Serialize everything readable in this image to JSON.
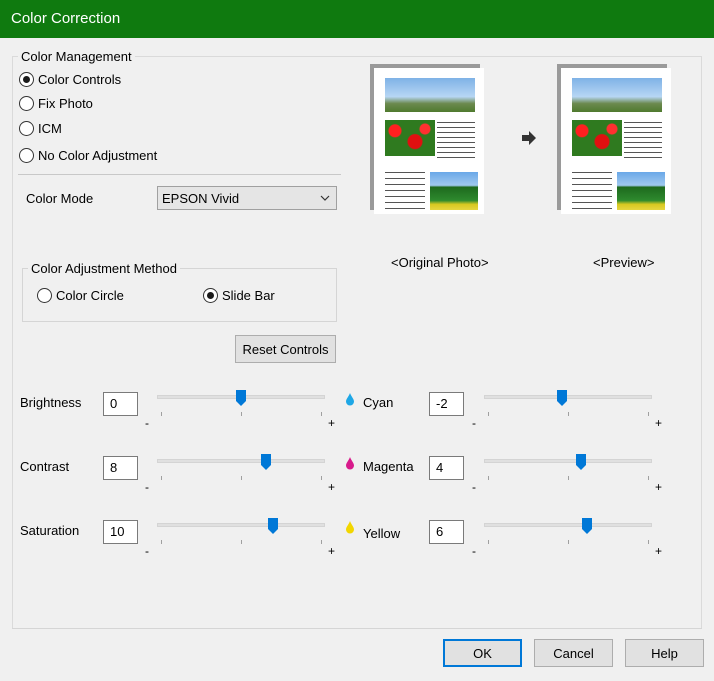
{
  "window": {
    "title": "Color Correction"
  },
  "color_management": {
    "legend": "Color Management",
    "options": [
      {
        "label": "Color Controls",
        "checked": true
      },
      {
        "label": "Fix Photo",
        "checked": false
      },
      {
        "label": "ICM",
        "checked": false
      },
      {
        "label": "No Color Adjustment",
        "checked": false
      }
    ],
    "color_mode_label": "Color Mode",
    "color_mode_value": "EPSON Vivid"
  },
  "preview": {
    "original_label": "<Original Photo>",
    "preview_label": "<Preview>"
  },
  "adjustment_method": {
    "legend": "Color Adjustment Method",
    "options": [
      {
        "label": "Color Circle",
        "checked": false
      },
      {
        "label": "Slide Bar",
        "checked": true
      }
    ]
  },
  "reset_button": "Reset Controls",
  "sliders": [
    {
      "label": "Brightness",
      "value": "0",
      "min": -25,
      "max": 25,
      "pos": 0
    },
    {
      "label": "Contrast",
      "value": "8",
      "min": -25,
      "max": 25,
      "pos": 8
    },
    {
      "label": "Saturation",
      "value": "10",
      "min": -25,
      "max": 25,
      "pos": 10
    },
    {
      "label": "Cyan",
      "value": "-2",
      "min": -25,
      "max": 25,
      "pos": -2,
      "color": "#1ea7e6"
    },
    {
      "label": "Magenta",
      "value": "4",
      "min": -25,
      "max": 25,
      "pos": 4,
      "color": "#d81b8c"
    },
    {
      "label": "Yellow",
      "value": "6",
      "min": -25,
      "max": 25,
      "pos": 6,
      "color": "#f2d600"
    }
  ],
  "slider_minus": "-",
  "slider_plus": "+",
  "buttons": {
    "ok": "OK",
    "cancel": "Cancel",
    "help": "Help"
  },
  "colors": {
    "titlebar": "#0f7a0f",
    "accent": "#0078d7"
  }
}
